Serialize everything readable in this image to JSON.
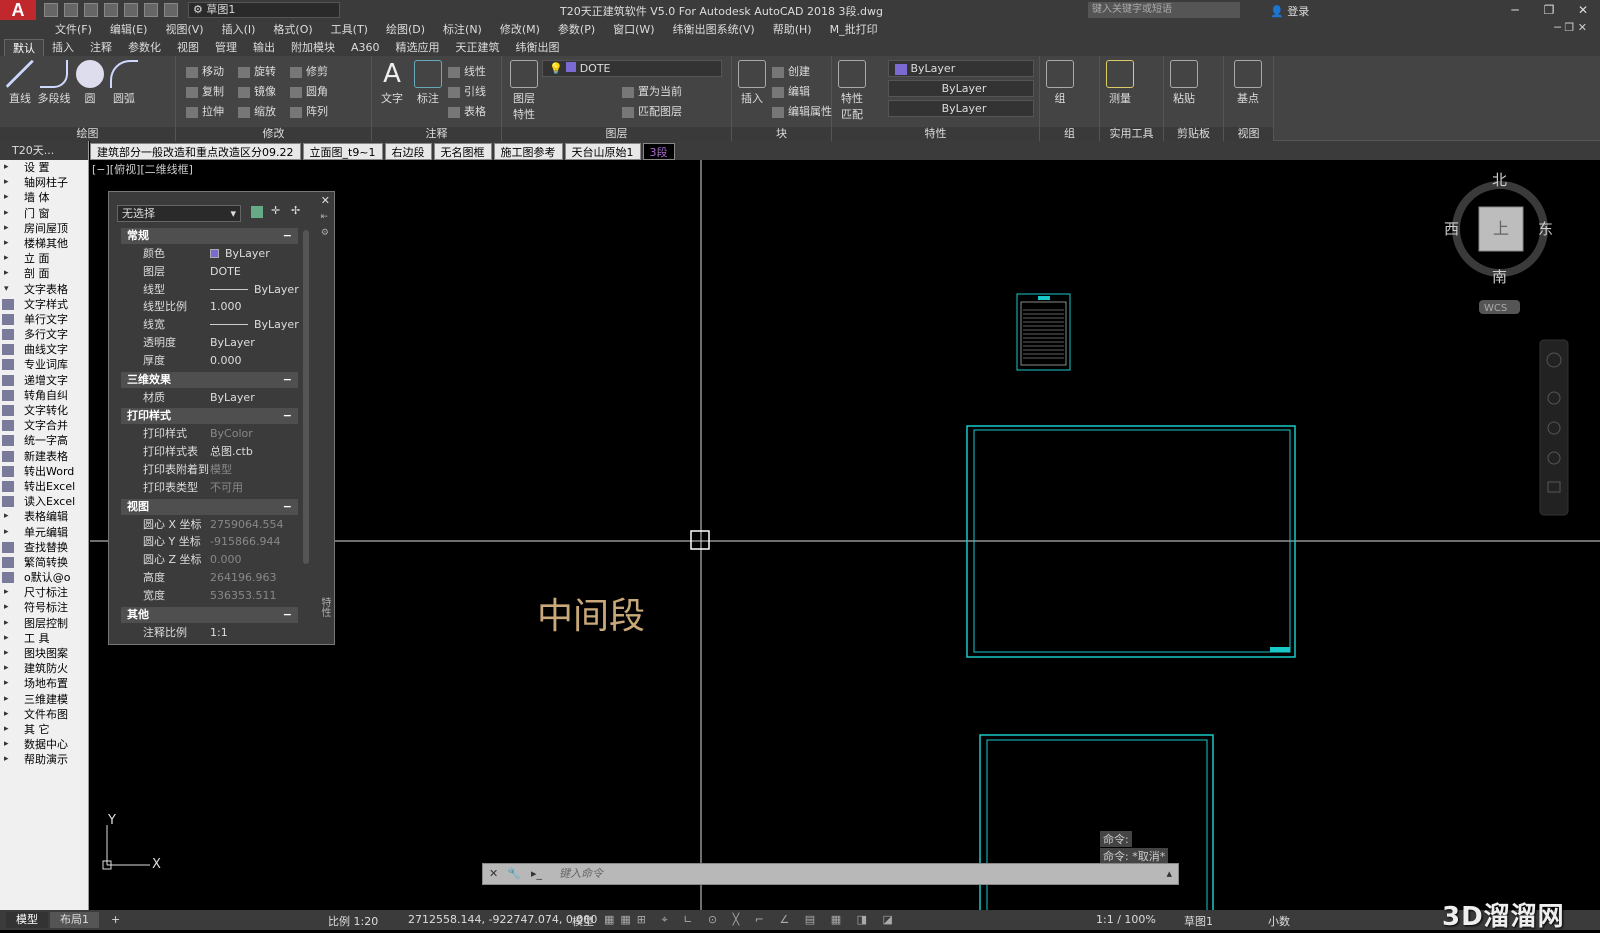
{
  "window": {
    "title": "T20天正建筑软件 V5.0 For Autodesk AutoCAD 2018     3段.dwg",
    "workspace": "草图1",
    "search_placeholder": "键入关键字或短语",
    "login": "登录"
  },
  "menu": [
    "文件(F)",
    "编辑(E)",
    "视图(V)",
    "插入(I)",
    "格式(O)",
    "工具(T)",
    "绘图(D)",
    "标注(N)",
    "修改(M)",
    "参数(P)",
    "窗口(W)",
    "纬衡出图系统(V)",
    "帮助(H)",
    "M_批打印"
  ],
  "ribbon_tabs": [
    "默认",
    "插入",
    "注释",
    "参数化",
    "视图",
    "管理",
    "输出",
    "附加模块",
    "A360",
    "精选应用",
    "天正建筑",
    "纬衡出图"
  ],
  "ribbon": {
    "draw": {
      "label": "绘图",
      "line": "直线",
      "polyline": "多段线",
      "circle": "圆",
      "arc": "圆弧"
    },
    "modify": {
      "label": "修改",
      "move": "移动",
      "rotate": "旋转",
      "trim": "修剪",
      "copy": "复制",
      "mirror": "镜像",
      "fillet": "圆角",
      "stretch": "拉伸",
      "scale": "缩放",
      "array": "阵列"
    },
    "annotation": {
      "label": "注释",
      "text": "文字",
      "dimension": "标注",
      "linear": "线性",
      "leader": "引线",
      "table": "表格"
    },
    "layers": {
      "label": "图层",
      "properties_1": "图层",
      "properties_2": "特性",
      "current_layer": "DOTE",
      "set_current": "置为当前",
      "match_layer": "匹配图层"
    },
    "block": {
      "label": "块",
      "insert": "插入",
      "create": "创建",
      "edit": "编辑",
      "edit_attr": "编辑属性"
    },
    "properties": {
      "label": "特性",
      "match_1": "特性",
      "match_2": "匹配",
      "color": "ByLayer",
      "linetype": "ByLayer",
      "lineweight": "ByLayer"
    },
    "groups": {
      "label": "组",
      "group": "组"
    },
    "utilities": {
      "label": "实用工具",
      "measure": "测量"
    },
    "clipboard": {
      "label": "剪贴板",
      "paste": "粘贴"
    },
    "view": {
      "label": "视图",
      "base": "基点"
    }
  },
  "file_tabs": [
    "建筑部分一般改造和重点改造区分09.22",
    "立面图_t9~1",
    "右边段",
    "无名图框",
    "施工图参考",
    "天台山原始1",
    "3段"
  ],
  "left_panel": {
    "header": "T20天...",
    "items": [
      {
        "label": "设    置",
        "type": "menu"
      },
      {
        "label": "轴网柱子",
        "type": "menu"
      },
      {
        "label": "墙    体",
        "type": "menu"
      },
      {
        "label": "门    窗",
        "type": "menu"
      },
      {
        "label": "房间屋顶",
        "type": "menu"
      },
      {
        "label": "楼梯其他",
        "type": "menu"
      },
      {
        "label": "立    面",
        "type": "menu"
      },
      {
        "label": "剖    面",
        "type": "menu"
      },
      {
        "label": "文字表格",
        "type": "open"
      },
      {
        "label": "文字样式",
        "type": "sub"
      },
      {
        "label": "单行文字",
        "type": "sub"
      },
      {
        "label": "多行文字",
        "type": "sub"
      },
      {
        "label": "曲线文字",
        "type": "sub"
      },
      {
        "label": "专业词库",
        "type": "sub"
      },
      {
        "label": "递增文字",
        "type": "sub"
      },
      {
        "label": "转角自纠",
        "type": "sub"
      },
      {
        "label": "文字转化",
        "type": "sub"
      },
      {
        "label": "文字合并",
        "type": "sub"
      },
      {
        "label": "统一字高",
        "type": "sub"
      },
      {
        "label": "新建表格",
        "type": "sub"
      },
      {
        "label": "转出Word",
        "type": "sub"
      },
      {
        "label": "转出Excel",
        "type": "sub"
      },
      {
        "label": "读入Excel",
        "type": "sub"
      },
      {
        "label": "表格编辑",
        "type": "menu"
      },
      {
        "label": "单元编辑",
        "type": "menu"
      },
      {
        "label": "查找替换",
        "type": "sub"
      },
      {
        "label": "繁简转换",
        "type": "sub"
      },
      {
        "label": "o默认@o",
        "type": "sub"
      },
      {
        "label": "尺寸标注",
        "type": "menu"
      },
      {
        "label": "符号标注",
        "type": "menu"
      },
      {
        "label": "图层控制",
        "type": "menu"
      },
      {
        "label": "工    具",
        "type": "menu"
      },
      {
        "label": "图块图案",
        "type": "menu"
      },
      {
        "label": "建筑防火",
        "type": "menu"
      },
      {
        "label": "场地布置",
        "type": "menu"
      },
      {
        "label": "三维建模",
        "type": "menu"
      },
      {
        "label": "文件布图",
        "type": "menu"
      },
      {
        "label": "其    它",
        "type": "menu"
      },
      {
        "label": "数据中心",
        "type": "menu"
      },
      {
        "label": "帮助演示",
        "type": "menu"
      }
    ]
  },
  "viewport_label": "[−][俯视][二维线框]",
  "properties_palette": {
    "selection": "无选择",
    "sections": [
      {
        "title": "常规",
        "rows": [
          [
            "颜色",
            "ByLayer"
          ],
          [
            "图层",
            "DOTE"
          ],
          [
            "线型",
            "ByLayer"
          ],
          [
            "线型比例",
            "1.000"
          ],
          [
            "线宽",
            "ByLayer"
          ],
          [
            "透明度",
            "ByLayer"
          ],
          [
            "厚度",
            "0.000"
          ]
        ]
      },
      {
        "title": "三维效果",
        "rows": [
          [
            "材质",
            "ByLayer"
          ]
        ]
      },
      {
        "title": "打印样式",
        "rows": [
          [
            "打印样式",
            "ByColor"
          ],
          [
            "打印样式表",
            "总图.ctb"
          ],
          [
            "打印表附着到",
            "模型"
          ],
          [
            "打印表类型",
            "不可用"
          ]
        ]
      },
      {
        "title": "视图",
        "rows": [
          [
            "圆心 X 坐标",
            "2759064.554"
          ],
          [
            "圆心 Y 坐标",
            "-915866.944"
          ],
          [
            "圆心 Z 坐标",
            "0.000"
          ],
          [
            "高度",
            "264196.963"
          ],
          [
            "宽度",
            "536353.511"
          ]
        ]
      },
      {
        "title": "其他",
        "rows": [
          [
            "注释比例",
            "1:1"
          ]
        ]
      }
    ],
    "side_label": "特性"
  },
  "drawing": {
    "text": "中间段",
    "text_color": "#c9a97a",
    "frame_color": "#19c8c8"
  },
  "viewcube": {
    "north": "北",
    "south": "南",
    "east": "东",
    "west": "西",
    "top": "上",
    "wcs": "WCS"
  },
  "ucs": {
    "x": "X",
    "y": "Y"
  },
  "command": {
    "placeholder": "键入命令",
    "history": [
      "命令:",
      "命令: *取消*"
    ]
  },
  "status": {
    "tabs": [
      "模型",
      "布局1"
    ],
    "scale": "比例 1:20",
    "coords": "2712558.144, -922747.074, 0.000",
    "model": "模型",
    "anno_scale": "1:1 / 100%",
    "workspace": "草图1",
    "units": "小数"
  },
  "watermark": "3D溜溜网"
}
